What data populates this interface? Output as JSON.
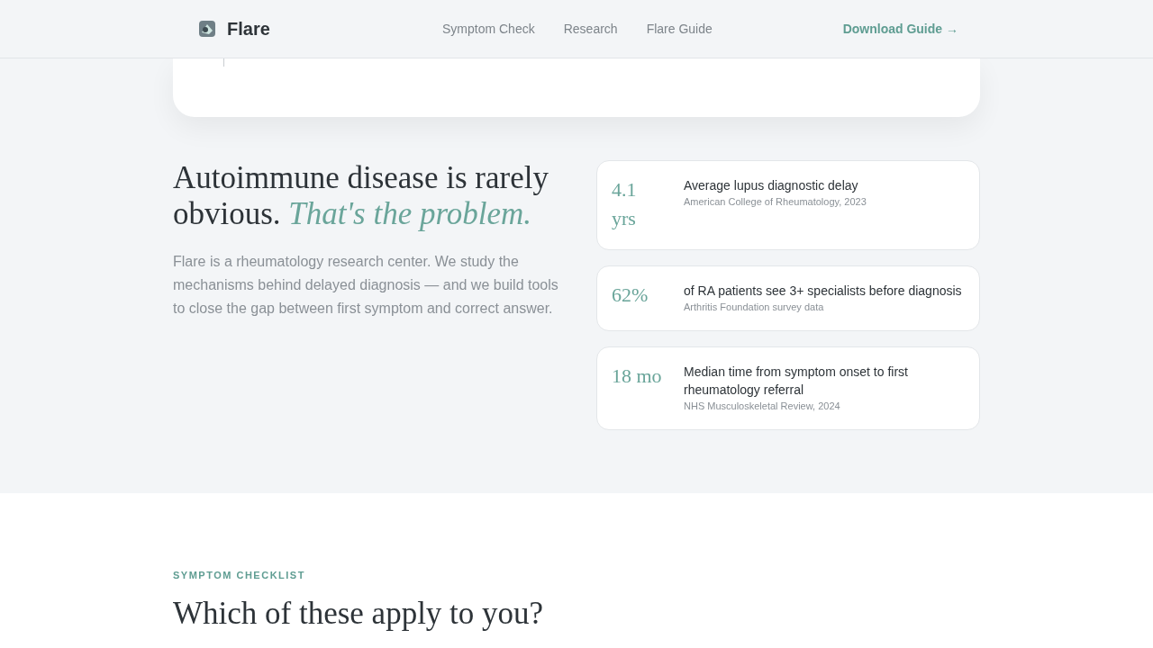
{
  "header": {
    "brand": "Flare",
    "nav": [
      {
        "label": "Symptom Check"
      },
      {
        "label": "Research"
      },
      {
        "label": "Flare Guide"
      }
    ],
    "cta": "Download Guide →"
  },
  "intro": {
    "headline": "Autoimmune disease is rarely obvious. *That's the problem.*",
    "body": "Flare is a rheumatology research center. We study the mechanisms behind delayed diagnosis — and we build tools to close the gap between first symptom and correct answer.",
    "stats": [
      {
        "value": "4.1 yrs",
        "label": "Average lupus diagnostic delay",
        "source": "American College of Rheumatology, 2023"
      },
      {
        "value": "62%",
        "label": "of RA patients see 3+ specialists before diagnosis",
        "source": "Arthritis Foundation survey data"
      },
      {
        "value": "18 mo",
        "label": "Median time from symptom onset to first rheumatology referral",
        "source": "NHS Musculoskeletal Review, 2024"
      }
    ]
  },
  "checklist": {
    "eyebrow": "SYMPTOM CHECKLIST",
    "heading": "Which of these apply to you?"
  }
}
